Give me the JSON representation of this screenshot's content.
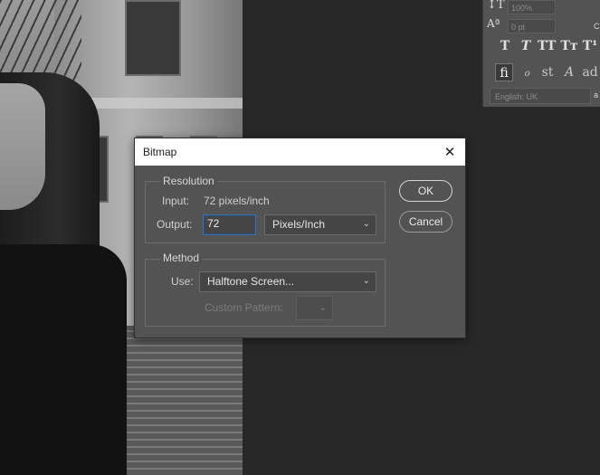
{
  "character_panel": {
    "leading_value": "100%",
    "baseline_value": "0 pt",
    "style_buttons": [
      "T",
      "T",
      "TT",
      "Tт",
      "T¹"
    ],
    "opentype_buttons": [
      "fi",
      "ℴ",
      "st",
      "A",
      "ad"
    ],
    "language": "English: UK",
    "right_label_1": "C",
    "right_label_2": "a"
  },
  "dialog": {
    "title": "Bitmap",
    "close_glyph": "✕",
    "resolution": {
      "group_label": "Resolution",
      "input_label": "Input:",
      "input_value": "72 pixels/inch",
      "output_label": "Output:",
      "output_value": "72",
      "unit": "Pixels/Inch"
    },
    "method": {
      "group_label": "Method",
      "use_label": "Use:",
      "use_value": "Halftone Screen...",
      "custom_pattern_label": "Custom Pattern:"
    },
    "ok_label": "OK",
    "cancel_label": "Cancel"
  }
}
